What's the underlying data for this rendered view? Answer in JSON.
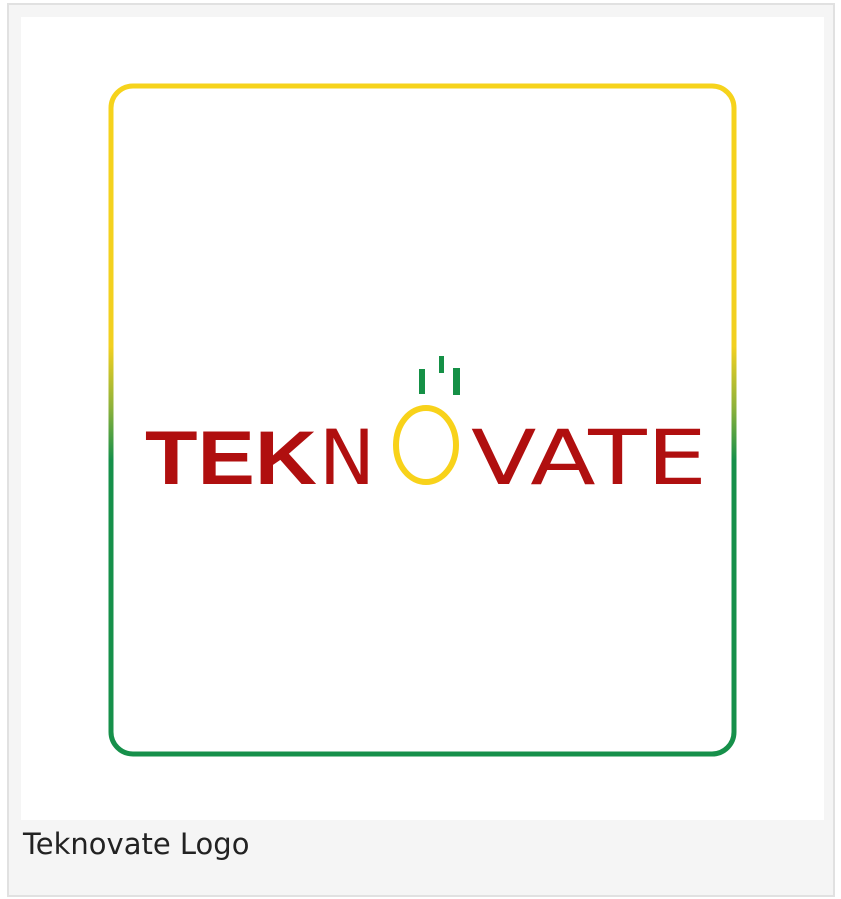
{
  "figure": {
    "caption": "Teknovate Logo",
    "logo": {
      "wordmark": "TEKNOVATE",
      "wordmark_bold_part": "TEK",
      "wordmark_n": "N",
      "wordmark_light_part": "VATE",
      "colors": {
        "text_red": "#b00f0f",
        "ring_yellow": "#f8d21a",
        "steam_green": "#159046",
        "frame_top": "#f6d31c",
        "frame_bottom": "#16904a",
        "background": "#ffffff",
        "card_background": "#f5f5f5",
        "card_border": "#e1e1e1"
      }
    }
  }
}
